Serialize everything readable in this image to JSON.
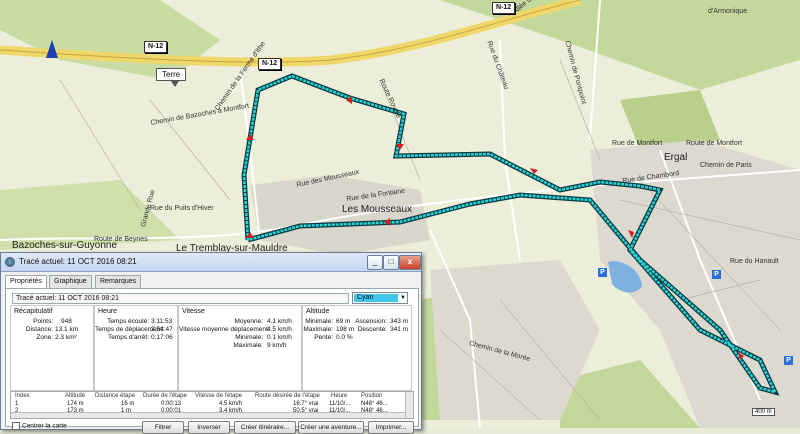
{
  "map": {
    "callout_text": "Terre",
    "road_shields": [
      "N-12",
      "N-12",
      "N-12"
    ],
    "town_labels": [
      "Les Mousseaux",
      "Bazoches-sur-Guyonne",
      "Le Tremblay-sur-Mauldre",
      "Ergal"
    ],
    "street_labels": [
      "Chemin de la Ferme d'Ithe",
      "Route Royale",
      "Rue des Mousseaux",
      "Rue de la Fontaine",
      "Rue du Puits d'Hiver",
      "Route de Beynes",
      "Grande Rue",
      "Chemin de Bazoches à Montfort",
      "Route de Montfort",
      "Chemin de Paris",
      "Rue du Hanault",
      "Rue de Chambord",
      "Rue de Montfort",
      "Allée du Bois",
      "d'Armonique",
      "Rue du Château",
      "Chemin de Pontpoint",
      "Chemin de la Morée"
    ],
    "scale_text": "400 m",
    "track_color": "#1fb8c8"
  },
  "dialog": {
    "title": "Tracé actuel: 11 OCT 2016 08:21",
    "tabs": [
      "Propriétés",
      "Graphique",
      "Remarques"
    ],
    "active_tab": "Propriétés",
    "name_field": "Tracé actuel: 11 OCT 2016 08:21",
    "color_value": "Cyan",
    "summary": {
      "title": "Récapitulatif",
      "rows": [
        {
          "k": "Points:",
          "v": "948"
        },
        {
          "k": "Distance:",
          "v": "13.1 km"
        },
        {
          "k": "Zone:",
          "v": "2.3 km²"
        }
      ]
    },
    "time": {
      "title": "Heure",
      "rows": [
        {
          "k": "Temps écoulé:",
          "v": "3:11:53"
        },
        {
          "k": "Temps de déplacement:",
          "v": "2:54:47"
        },
        {
          "k": "Temps d'arrêt:",
          "v": "0:17:06"
        }
      ]
    },
    "speed": {
      "title": "Vitesse",
      "rows": [
        {
          "k": "Moyenne:",
          "v": "4.1 km/h"
        },
        {
          "k": "Vitesse moyenne déplacement:",
          "v": "4.5 km/h"
        },
        {
          "k": "Minimale:",
          "v": "0.1 km/h"
        },
        {
          "k": "Maximale:",
          "v": "9 km/h"
        }
      ]
    },
    "altitude": {
      "title": "Altitude",
      "rows": [
        {
          "k": "Minimale:",
          "v": "69 m",
          "k2": "Ascension:",
          "v2": "343 m"
        },
        {
          "k": "Maximale:",
          "v": "198 m",
          "k2": "Descente:",
          "v2": "341 m"
        },
        {
          "k": "Pente:",
          "v": "0.0 %",
          "k2": "",
          "v2": ""
        }
      ]
    },
    "table": {
      "headers": [
        "Index",
        "Altitude",
        "Distance étape",
        "Durée de l'étape",
        "Vitesse de l'étape",
        "Route désirée de l'étape",
        "Heure",
        "Position"
      ],
      "rows": [
        [
          "1",
          "174 m",
          "16 m",
          "0:00:13",
          "4.5 km/h",
          "16.7° vrai",
          "11/10/...",
          "N48° 46..."
        ],
        [
          "2",
          "173 m",
          "1 m",
          "0:00:01",
          "3.4 km/h",
          "50.5° vrai",
          "11/10/...",
          "N48° 46..."
        ]
      ]
    },
    "center_checkbox": "Centrer la carte",
    "buttons": [
      "Filtrer",
      "Inverser",
      "Créer itinéraire...",
      "Créer une aventure...",
      "Imprimer..."
    ]
  }
}
